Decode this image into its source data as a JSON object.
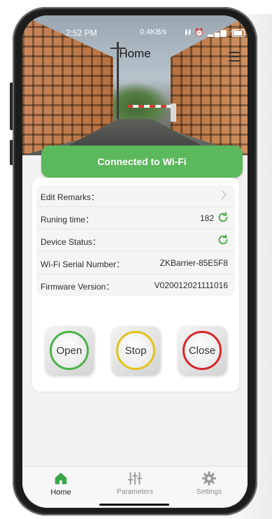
{
  "status_bar": {
    "time": "2:52 PM",
    "speed": "0.4KB/s",
    "icons": [
      "hd-icon",
      "alarm-icon",
      "signal-icon",
      "signal-icon",
      "wifi-icon",
      "battery-icon"
    ]
  },
  "header": {
    "title": "Home"
  },
  "wifi_banner": {
    "label": "Connected to Wi-Fi",
    "color": "#5cb85c"
  },
  "info": {
    "rows": [
      {
        "label": "Edit Remarks：",
        "value": ""
      },
      {
        "label": "Runing time：",
        "value": "182"
      },
      {
        "label": "Device Status：",
        "value": ""
      },
      {
        "label": "Wi-Fi Serial Number：",
        "value": "ZKBarrier-85E5F8"
      },
      {
        "label": "Firmware Version：",
        "value": "V020012021111016"
      }
    ]
  },
  "controls": {
    "open": {
      "label": "Open",
      "color": "#4bb24b"
    },
    "stop": {
      "label": "Stop",
      "color": "#e3c21a"
    },
    "close": {
      "label": "Close",
      "color": "#d8262a"
    }
  },
  "nav": {
    "items": [
      {
        "label": "Home",
        "icon": "home-icon",
        "active": true
      },
      {
        "label": "Parameters",
        "icon": "sliders-icon",
        "active": false
      },
      {
        "label": "Settings",
        "icon": "gear-icon",
        "active": false
      }
    ]
  }
}
